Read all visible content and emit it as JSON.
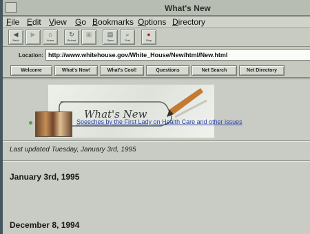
{
  "window": {
    "title": "What's New"
  },
  "menu": {
    "items": [
      "File",
      "Edit",
      "View",
      "Go",
      "Bookmarks",
      "Options",
      "Directory"
    ]
  },
  "toolbar": {
    "buttons": [
      {
        "label": "Back",
        "icon": "back-arrow-icon"
      },
      {
        "label": "Forward",
        "icon": "forward-arrow-icon"
      },
      {
        "label": "Home",
        "icon": "home-icon"
      },
      {
        "label": "Reload",
        "icon": "reload-icon"
      },
      {
        "label": "Images",
        "icon": "images-icon"
      },
      {
        "label": "Open",
        "icon": "open-icon"
      },
      {
        "label": "Find",
        "icon": "find-icon"
      },
      {
        "label": "Stop",
        "icon": "stop-icon"
      }
    ]
  },
  "location": {
    "label": "Location:",
    "url": "http://www.whitehouse.gov/White_House/New/html/New.html"
  },
  "directory_buttons": [
    "Welcome",
    "What's New!",
    "What's Cool!",
    "Questions",
    "Net Search",
    "Net Directory"
  ],
  "content": {
    "banner_text": "What's New",
    "last_updated": "Last updated Tuesday, January 3rd, 1995",
    "sections": [
      {
        "date": "January 3rd, 1995",
        "link": "Speeches by the First Lady on Health Care and other issues"
      },
      {
        "date": "December 8, 1994"
      }
    ]
  },
  "colors": {
    "page_background": "#c9ccc4",
    "link": "#2943a8",
    "bullet": "#55a43a"
  }
}
